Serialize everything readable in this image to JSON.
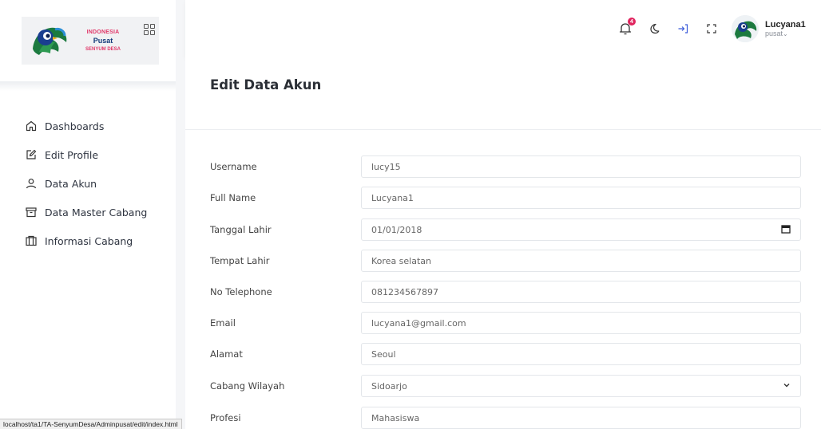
{
  "logo": {
    "line1": "INDONESIA",
    "line2": "Pusat",
    "line3": "SENYUM DESA",
    "accent": "#e0396a",
    "brand": "#123a7a"
  },
  "sidebar": {
    "items": [
      {
        "label": "Dashboards",
        "icon": "home-icon"
      },
      {
        "label": "Edit Profile",
        "icon": "edit-icon"
      },
      {
        "label": "Data Akun",
        "icon": "user-icon"
      },
      {
        "label": "Data Master Cabang",
        "icon": "archive-icon"
      },
      {
        "label": "Informasi Cabang",
        "icon": "building-icon"
      }
    ]
  },
  "topbar": {
    "notification_count": "4",
    "user_name": "Lucyana1",
    "user_role": "pusat"
  },
  "page": {
    "title": "Edit Data Akun"
  },
  "form": {
    "fields": [
      {
        "label": "Username",
        "value": "lucy15"
      },
      {
        "label": "Full Name",
        "value": "Lucyana1"
      },
      {
        "label": "Tanggal Lahir",
        "value": "01/01/2018"
      },
      {
        "label": "Tempat Lahir",
        "value": "Korea selatan"
      },
      {
        "label": "No Telephone",
        "value": "081234567897"
      },
      {
        "label": "Email",
        "value": "lucyana1@gmail.com"
      },
      {
        "label": "Alamat",
        "value": "Seoul"
      },
      {
        "label": "Cabang Wilayah",
        "value": "Sidoarjo"
      },
      {
        "label": "Profesi",
        "value": "Mahasiswa"
      }
    ]
  },
  "status_bar": {
    "url": "localhost/ta1/TA-SenyumDesa/Adminpusat/edit/index.html"
  }
}
